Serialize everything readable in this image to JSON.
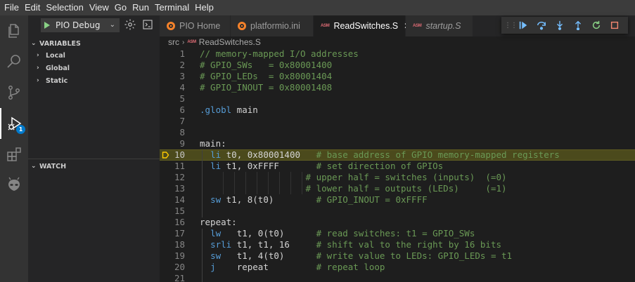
{
  "menu": [
    "File",
    "Edit",
    "Selection",
    "View",
    "Go",
    "Run",
    "Terminal",
    "Help"
  ],
  "activity": {
    "debug_badge": "1"
  },
  "sidebar": {
    "config_label": "PIO Debug",
    "variables_header": "VARIABLES",
    "variables_items": [
      "Local",
      "Global",
      "Static"
    ],
    "watch_header": "WATCH"
  },
  "tabs": [
    {
      "label": "PIO Home",
      "icon": "platformio-icon"
    },
    {
      "label": "platformio.ini",
      "icon": "platformio-icon"
    },
    {
      "label": "ReadSwitches.S",
      "icon": "asm-icon",
      "active": true
    },
    {
      "label": "startup.S",
      "icon": "asm-icon",
      "italic": true
    }
  ],
  "asm_icon_text": "ASM",
  "breadcrumb": {
    "folder": "src",
    "file": "ReadSwitches.S"
  },
  "debug_toolbar": [
    "continue",
    "step-over",
    "step-into",
    "step-out",
    "restart",
    "stop"
  ],
  "editor": {
    "current_line": 10,
    "lines": [
      {
        "n": "1",
        "parts": [
          [
            "c-com",
            "// memory-mapped I/O addresses"
          ]
        ]
      },
      {
        "n": "2",
        "parts": [
          [
            "c-com",
            "# GPIO_SWs   = 0x80001400"
          ]
        ]
      },
      {
        "n": "3",
        "parts": [
          [
            "c-com",
            "# GPIO_LEDs  = 0x80001404"
          ]
        ]
      },
      {
        "n": "4",
        "parts": [
          [
            "c-com",
            "# GPIO_INOUT = 0x80001408"
          ]
        ]
      },
      {
        "n": "5",
        "parts": []
      },
      {
        "n": "6",
        "parts": [
          [
            "c-kw",
            ".globl"
          ],
          [
            "c-txt",
            " main"
          ]
        ]
      },
      {
        "n": "7",
        "parts": []
      },
      {
        "n": "8",
        "parts": []
      },
      {
        "n": "9",
        "parts": [
          [
            "c-lbl",
            "main:"
          ]
        ]
      },
      {
        "n": "10",
        "parts": [
          [
            "c-txt",
            "  "
          ],
          [
            "c-kw",
            "li"
          ],
          [
            "c-txt",
            " t0, 0x80001400   "
          ],
          [
            "c-com",
            "# base address of GPIO memory-mapped registers"
          ]
        ]
      },
      {
        "n": "11",
        "parts": [
          [
            "c-txt",
            "  "
          ],
          [
            "c-kw",
            "li"
          ],
          [
            "c-txt",
            " t1, 0xFFFF       "
          ],
          [
            "c-com",
            "# set direction of GPIOs"
          ]
        ]
      },
      {
        "n": "12",
        "parts": [
          [
            "c-txt",
            "                    "
          ],
          [
            "c-com",
            "# upper half = switches (inputs)  (=0)"
          ]
        ]
      },
      {
        "n": "13",
        "parts": [
          [
            "c-txt",
            "                    "
          ],
          [
            "c-com",
            "# lower half = outputs (LEDs)     (=1)"
          ]
        ]
      },
      {
        "n": "14",
        "parts": [
          [
            "c-txt",
            "  "
          ],
          [
            "c-kw",
            "sw"
          ],
          [
            "c-txt",
            " t1, 8(t0)        "
          ],
          [
            "c-com",
            "# GPIO_INOUT = 0xFFFF"
          ]
        ]
      },
      {
        "n": "15",
        "parts": []
      },
      {
        "n": "16",
        "parts": [
          [
            "c-lbl",
            "repeat:"
          ]
        ]
      },
      {
        "n": "17",
        "parts": [
          [
            "c-txt",
            "  "
          ],
          [
            "c-kw",
            "lw"
          ],
          [
            "c-txt",
            "   t1, 0(t0)      "
          ],
          [
            "c-com",
            "# read switches: t1 = GPIO_SWs"
          ]
        ]
      },
      {
        "n": "18",
        "parts": [
          [
            "c-txt",
            "  "
          ],
          [
            "c-kw",
            "srli"
          ],
          [
            "c-txt",
            " t1, t1, 16     "
          ],
          [
            "c-com",
            "# shift val to the right by 16 bits"
          ]
        ]
      },
      {
        "n": "19",
        "parts": [
          [
            "c-txt",
            "  "
          ],
          [
            "c-kw",
            "sw"
          ],
          [
            "c-txt",
            "   t1, 4(t0)      "
          ],
          [
            "c-com",
            "# write value to LEDs: GPIO_LEDs = t1"
          ]
        ]
      },
      {
        "n": "20",
        "parts": [
          [
            "c-txt",
            "  "
          ],
          [
            "c-kw",
            "j"
          ],
          [
            "c-txt",
            "    repeat         "
          ],
          [
            "c-com",
            "# repeat loop"
          ]
        ]
      },
      {
        "n": "21",
        "parts": []
      }
    ]
  },
  "colors": {
    "accent": "#007acc",
    "current_line_bg": "#4b4a1c",
    "comment": "#6a9955",
    "keyword": "#569cd6",
    "continue": "#75beff",
    "restart": "#89d185",
    "stop": "#f48771",
    "breakpoint_arrow": "#ffcc00"
  }
}
